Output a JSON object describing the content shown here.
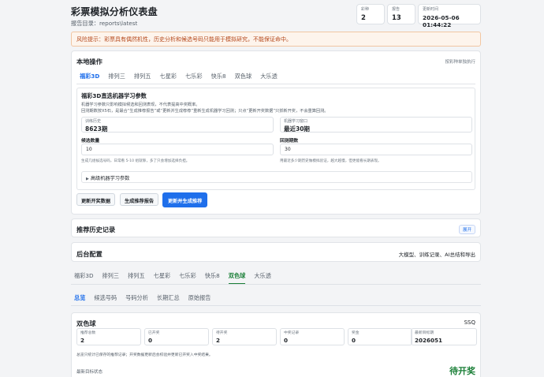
{
  "header": {
    "title": "彩票模拟分析仪表盘",
    "subtitle": "报告目录：reports\\latest",
    "stats": [
      {
        "label": "彩种",
        "value": "2"
      },
      {
        "label": "报告",
        "value": "13"
      },
      {
        "label": "更新时间",
        "value": "2026-05-06 01:44:22"
      }
    ]
  },
  "warning": "风险提示：彩票具有偶然机性，历史分析和候选号码只能用于模拟研究，不能保证命中。",
  "local_ops": {
    "title": "本地操作",
    "right_note": "按彩种单独执行",
    "tabs": [
      "福彩3D",
      "排列三",
      "排列五",
      "七星彩",
      "七乐彩",
      "快乐8",
      "双色球",
      "大乐透"
    ],
    "active_tab": 0,
    "panel": {
      "title": "福彩3D直选机器学习参数",
      "note1": "机器学习参数只影响模拟候选和回测表现，不代表提高中奖概率。",
      "note2": "回测期数按X5石，是最合“生成推荐报告”或“更新并生成荐荐”重新生成机器学习回测；只点“更新开奖数据”只抓新开奖，不会重算回测。",
      "train_label": "训练历史",
      "train_value": "8623期",
      "window_label": "机器学习窗口",
      "window_value": "最近30期",
      "cand_label": "候选数量",
      "cand_value": "10",
      "cand_hint": "生成几组候选号码，日常看 5-10 组就够，多了只会增加选择负担。",
      "back_label": "回测期数",
      "back_value": "30",
      "back_hint": "用最近多少期历史做模拟验证，越大越慢，但更能看长期表现。",
      "advanced": "高级机器学习参数"
    },
    "buttons": [
      "更新开奖数据",
      "生成推荐报告",
      "更新并生成推荐"
    ]
  },
  "history": {
    "title": "推荐历史记录",
    "badge": "展开"
  },
  "backend": {
    "title": "后台配置",
    "right": "大模型、训练记录、AI总结和导出"
  },
  "lottery_tabs": [
    "福彩3D",
    "排列三",
    "排列五",
    "七星彩",
    "七乐彩",
    "快乐8",
    "双色球",
    "大乐透"
  ],
  "lottery_active": 6,
  "sub_tabs": [
    "总览",
    "候选号码",
    "号码分析",
    "长期汇总",
    "原始报告"
  ],
  "sub_active": 0,
  "overview": {
    "title": "双色球",
    "code": "SSQ",
    "metrics": [
      {
        "label": "推荐总数",
        "value": "2"
      },
      {
        "label": "已开奖",
        "value": "0"
      },
      {
        "label": "待开奖",
        "value": "2"
      },
      {
        "label": "中奖记录",
        "value": "0"
      },
      {
        "label": "奖金",
        "value": "0"
      },
      {
        "label": "最新目标期",
        "value": "2026051"
      }
    ],
    "note": "总览只统计已保存的推荐记录；开奖数据更新后会校验并更新已开奖入中奖结果。",
    "latest_label": "最新目标状态",
    "latest_status": "待开奖"
  }
}
